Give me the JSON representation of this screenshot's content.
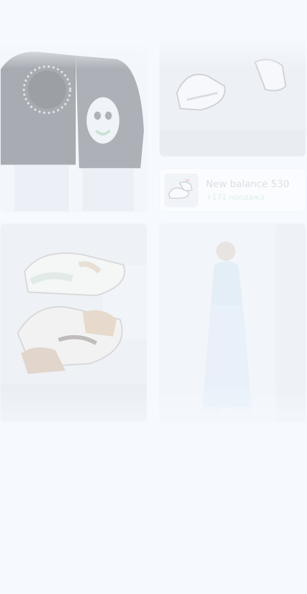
{
  "feed": {
    "cards": [
      {
        "name": "photo-couple-tshirts",
        "icon": "image-icon"
      },
      {
        "name": "photo-sneakers-white",
        "icon": "image-icon"
      },
      {
        "name": "photo-nike-sneakers",
        "icon": "image-icon"
      },
      {
        "name": "photo-woman-blue-outfit",
        "icon": "image-icon"
      }
    ],
    "product": {
      "name": "New balance 530",
      "sales": "+171 продажа"
    }
  },
  "colors": {
    "background": "#f6faff",
    "product_name": "#b9c0c9",
    "sales_green": "#bfe5c9"
  }
}
